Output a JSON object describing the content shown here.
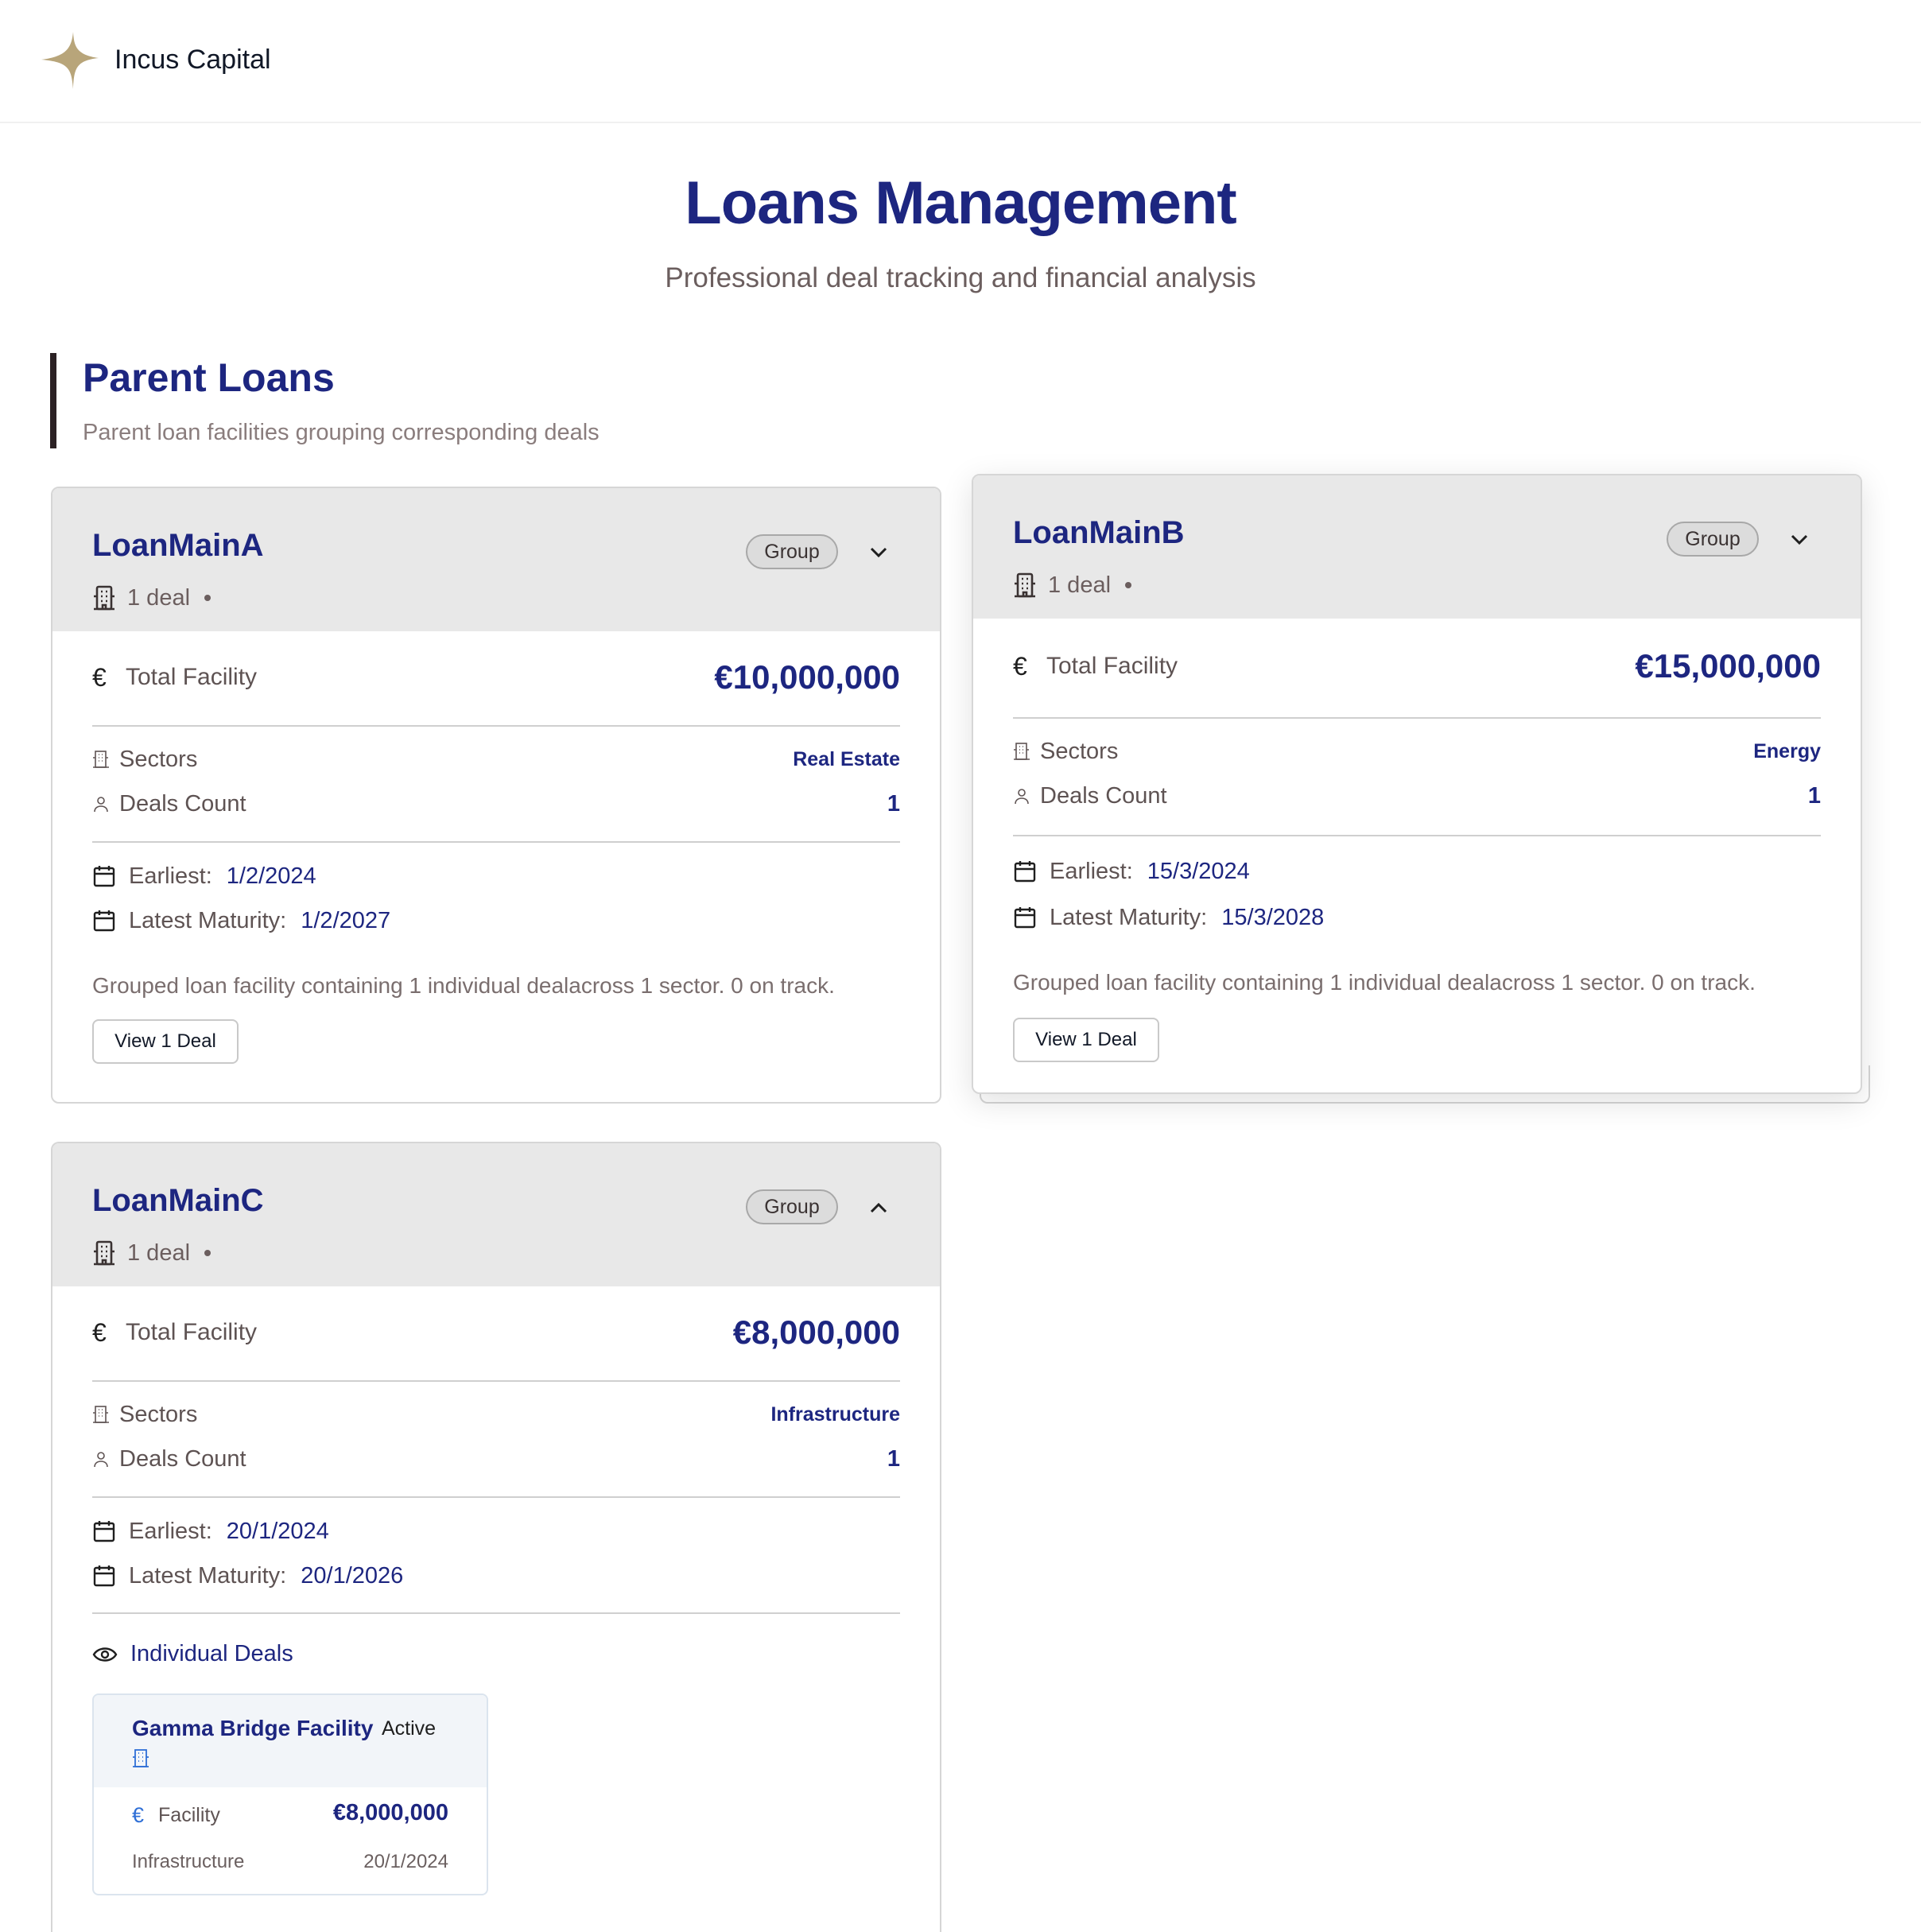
{
  "header": {
    "brand": "Incus Capital"
  },
  "page": {
    "title": "Loans Management",
    "subtitle": "Professional deal tracking and financial analysis"
  },
  "section": {
    "title": "Parent Loans",
    "subtitle": "Parent loan facilities grouping corresponding deals"
  },
  "labels": {
    "total_facility": "Total Facility",
    "sectors": "Sectors",
    "deals_count": "Deals Count",
    "earliest": "Earliest:",
    "latest_maturity": "Latest Maturity:",
    "badge": "Group",
    "individual_deals": "Individual Deals"
  },
  "loans": [
    {
      "name": "LoanMainA",
      "deals_meta": "1 deal",
      "total": "€10,000,000",
      "sector": "Real Estate",
      "count": "1",
      "earliest": "1/2/2024",
      "latest": "1/2/2027",
      "description": "Grouped loan facility containing 1 individual dealacross 1 sector. 0 on track.",
      "button": "View 1 Deal",
      "expanded": false
    },
    {
      "name": "LoanMainB",
      "deals_meta": "1 deal",
      "total": "€15,000,000",
      "sector": "Energy",
      "count": "1",
      "earliest": "15/3/2024",
      "latest": "15/3/2028",
      "description": "Grouped loan facility containing 1 individual dealacross 1 sector. 0 on track.",
      "button": "View 1 Deal",
      "expanded": false
    },
    {
      "name": "LoanMainC",
      "deals_meta": "1 deal",
      "total": "€8,000,000",
      "sector": "Infrastructure",
      "count": "1",
      "earliest": "20/1/2024",
      "latest": "20/1/2026",
      "expanded": true,
      "deals": [
        {
          "name": "Gamma Bridge Facility",
          "status": "Active",
          "facility_label": "Facility",
          "facility": "€8,000,000",
          "sector": "Infrastructure",
          "date": "20/1/2024"
        }
      ]
    }
  ],
  "colors": {
    "brand_navy": "#1d2680",
    "logo_gold": "#b8a57a",
    "header_bg": "#e8e8e8"
  }
}
